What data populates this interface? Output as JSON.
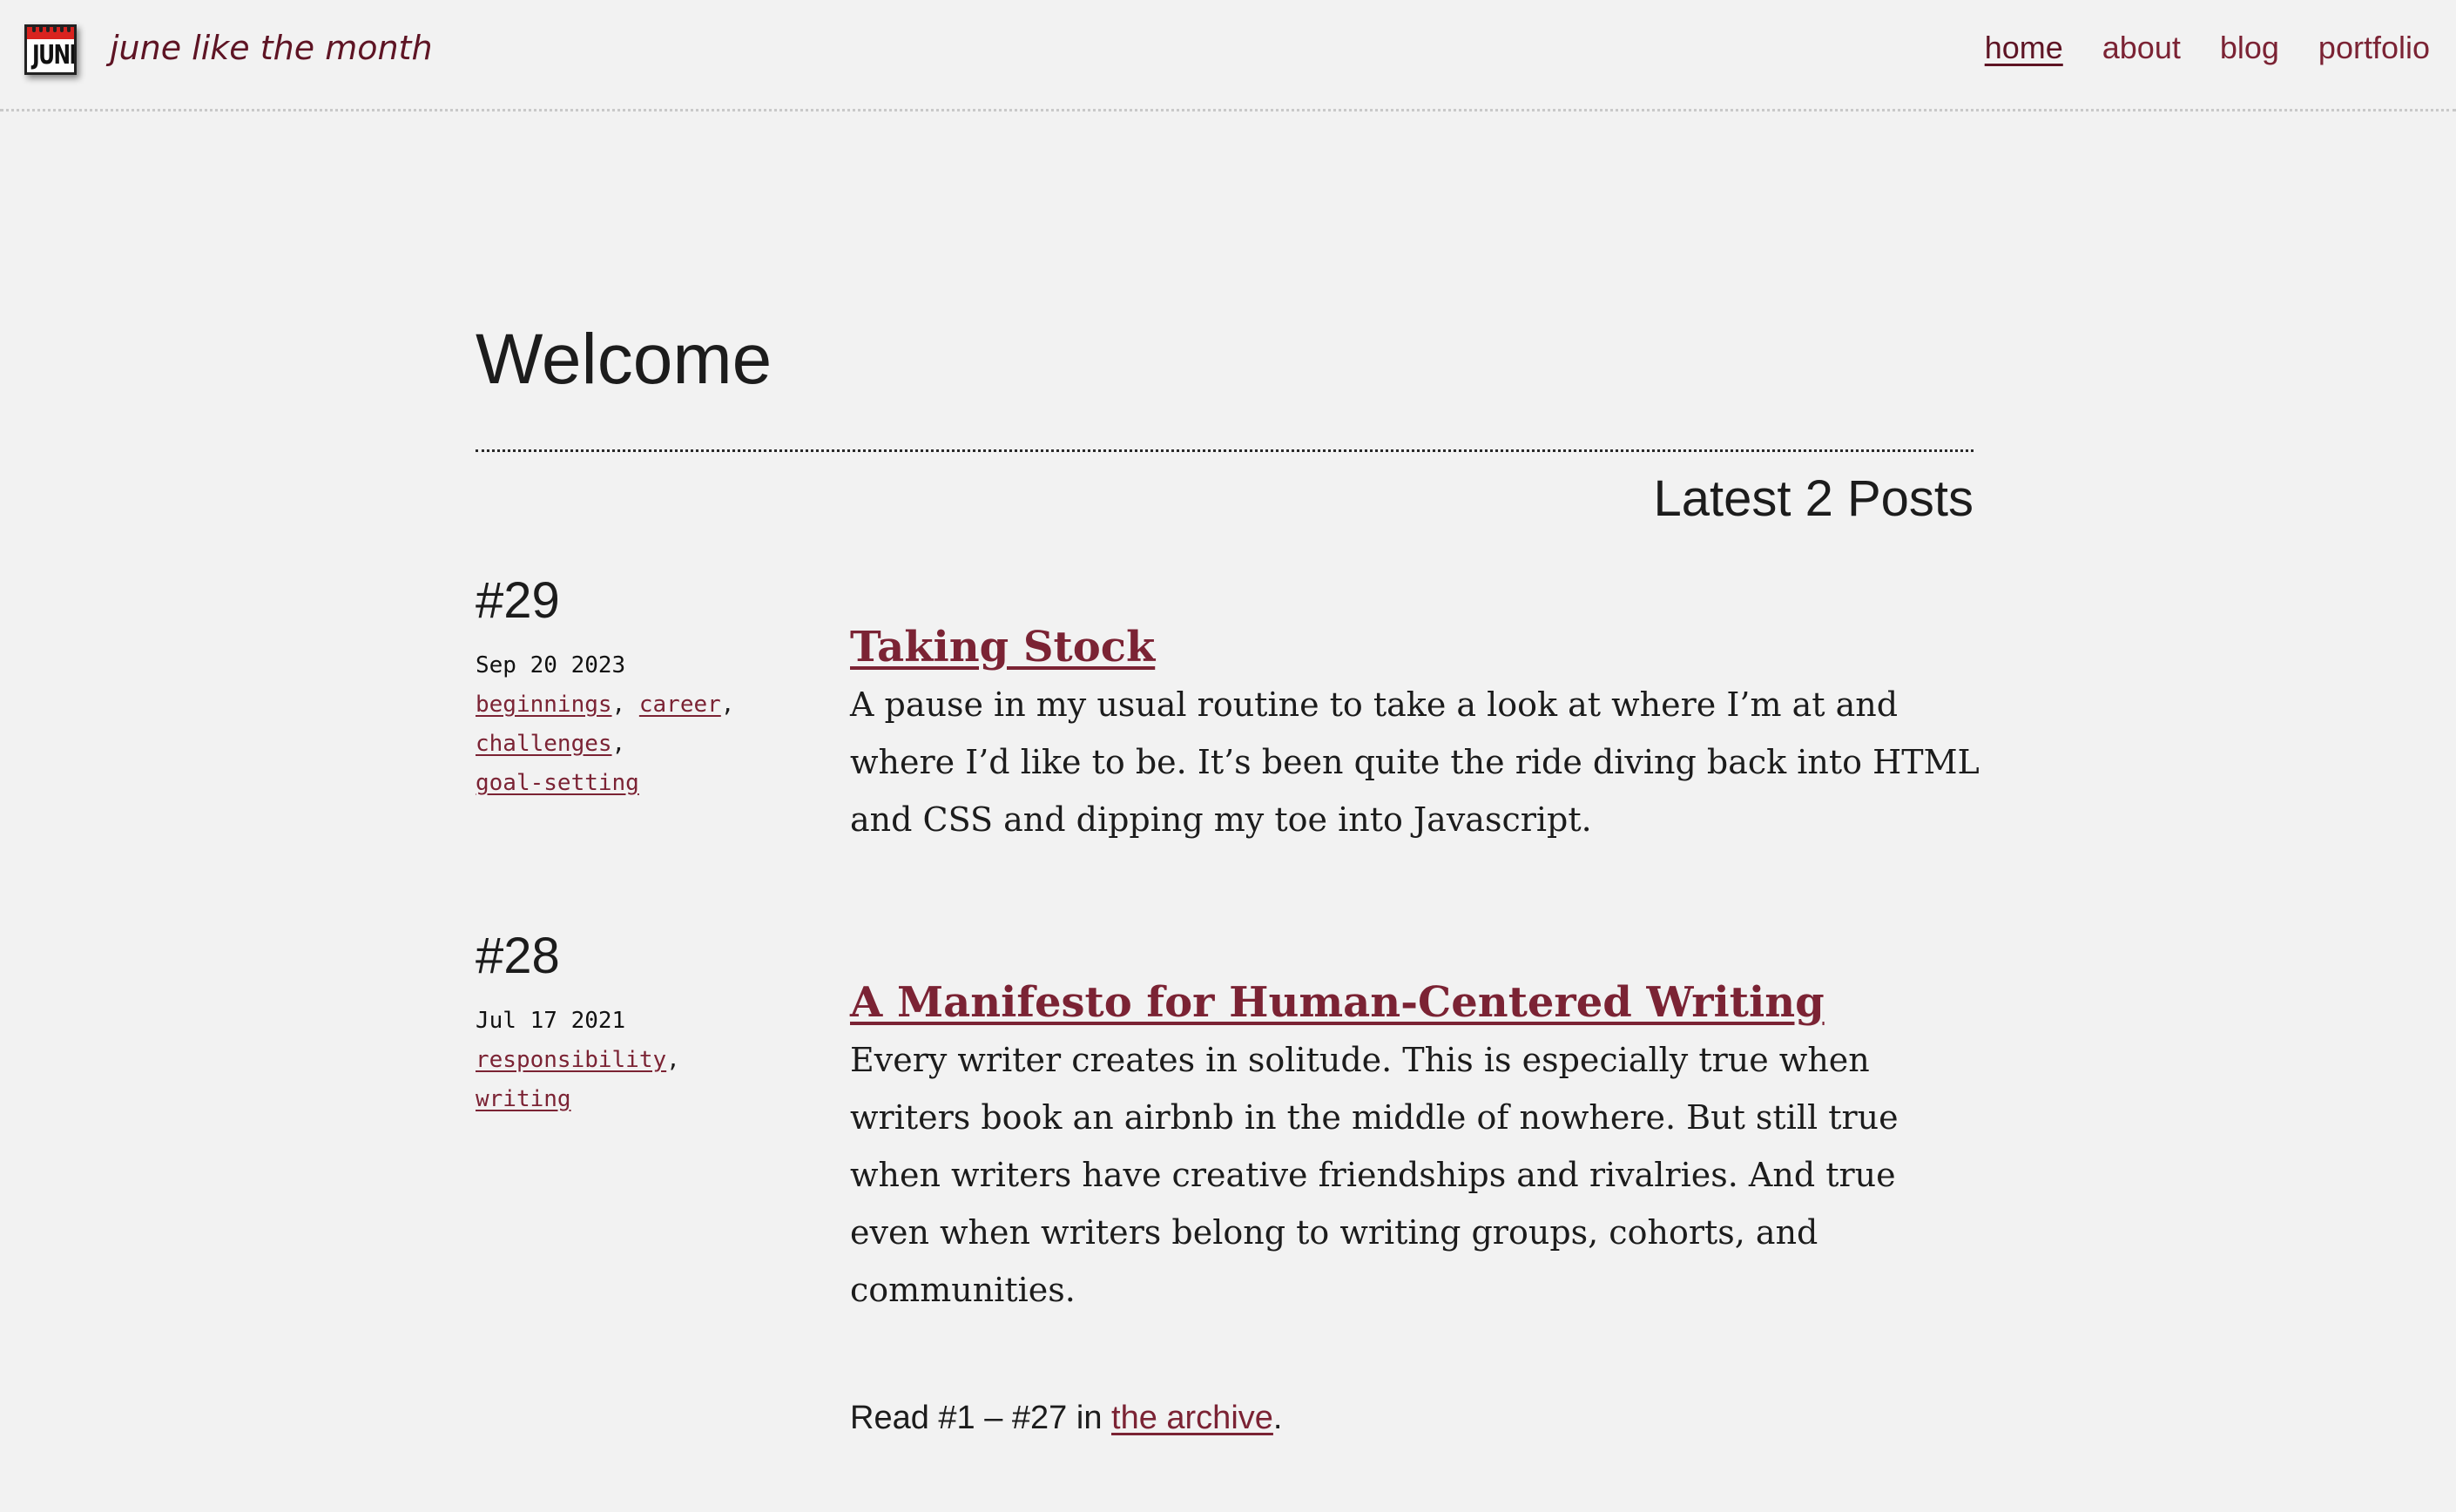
{
  "header": {
    "logo_text": "JUNE",
    "site_title": "june like the month",
    "nav": [
      {
        "label": "home",
        "active": true
      },
      {
        "label": "about",
        "active": false
      },
      {
        "label": "blog",
        "active": false
      },
      {
        "label": "portfolio",
        "active": false
      }
    ]
  },
  "main": {
    "title": "Welcome",
    "latest_heading": "Latest 2 Posts",
    "posts": [
      {
        "number": "#29",
        "date": "Sep 20 2023",
        "tags": [
          "beginnings",
          "career",
          "challenges",
          "goal-setting"
        ],
        "title": "Taking Stock",
        "excerpt": "A pause in my usual routine to take a look at where I’m at and where I’d like to be. It’s been quite the ride diving back into HTML and CSS and dipping my toe into Javascript."
      },
      {
        "number": "#28",
        "date": "Jul 17 2021",
        "tags": [
          "responsibility",
          "writing"
        ],
        "title": "A Manifesto for Human-Centered Writing",
        "excerpt": "Every writer creates in solitude. This is especially true when writers book an airbnb in the middle of nowhere. But still true when writers have creative friendships and rivalries. And true even when writers belong to writing groups, cohorts, and communities."
      }
    ],
    "archive": {
      "prefix": "Read #1 – #27 in ",
      "link_text": "the archive",
      "suffix": "."
    }
  },
  "colors": {
    "background": "#f2f2f2",
    "accent": "#7b2334",
    "text": "#1c1c1c",
    "logo_red": "#d9231f"
  }
}
